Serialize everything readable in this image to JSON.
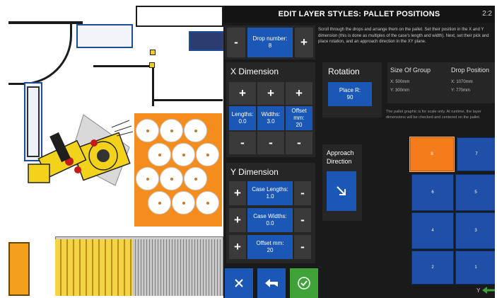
{
  "header": {
    "title": "EDIT LAYER STYLES: PALLET POSITIONS",
    "time": "2:2"
  },
  "drop": {
    "label": "Drop number:",
    "value": "8",
    "minus": "-",
    "plus": "+"
  },
  "instructions": "Scroll through the drops and arrange them on the pallet. Set their position in the X and Y dimension (this is done as multiples of the case's length and width). Next, set their pick and place rotation, and an approach direction in the XY plane.",
  "x_dimension": {
    "title": "X Dimension",
    "plus": "+",
    "minus": "-",
    "fields": [
      {
        "label": "Lengths:",
        "value": "0.0"
      },
      {
        "label": "Widths:",
        "value": "3.0"
      },
      {
        "label": "Offset mm:",
        "value": "20"
      }
    ]
  },
  "y_dimension": {
    "title": "Y Dimension",
    "plus": "+",
    "minus": "-",
    "fields": [
      {
        "label": "Case Lengths:",
        "value": "1.0"
      },
      {
        "label": "Case Widths:",
        "value": "0.0"
      },
      {
        "label": "Offset mm:",
        "value": "20"
      }
    ]
  },
  "rotation": {
    "title": "Rotation",
    "label": "Place R:",
    "value": "90"
  },
  "approach": {
    "title": "Approach Direction"
  },
  "group_info": {
    "size_title": "Size Of Group",
    "size_x": "X: 500mm",
    "size_y": "Y: 300mm",
    "pos_title": "Drop Position",
    "pos_x": "X: 1070mm",
    "pos_y": "Y: 770mm"
  },
  "note": "The pallet graphic is for scale only. At runtime, the layer dimensions will be checked and centered on the pallet.",
  "pallet": {
    "cells": [
      "8",
      "7",
      "6",
      "5",
      "4",
      "3",
      "2",
      "1"
    ],
    "active": "8",
    "axis_label": "Y"
  },
  "colors": {
    "accent_blue": "#1b57b4",
    "active_orange": "#f47c1b",
    "confirm_green": "#3fa33a",
    "panel_bg": "#1a1a1a"
  },
  "icons": {
    "cancel": "cross-icon",
    "back": "undo-arrow-icon",
    "confirm": "check-circle-icon",
    "approach": "arrow-down-right-icon"
  }
}
